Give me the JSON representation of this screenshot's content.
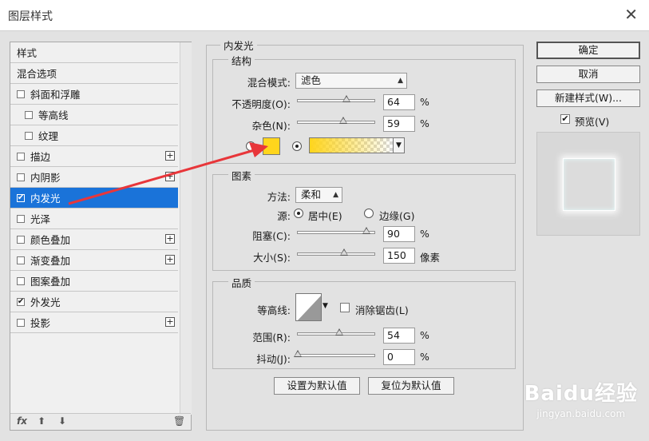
{
  "window": {
    "title": "图层样式",
    "close": "✕"
  },
  "style_list": {
    "items": [
      {
        "label": "样式",
        "checkbox": false,
        "plus": false,
        "indent": 0
      },
      {
        "label": "混合选项",
        "checkbox": false,
        "plus": false,
        "indent": 0
      },
      {
        "label": "斜面和浮雕",
        "checkbox": true,
        "checked": false,
        "plus": false,
        "indent": 0
      },
      {
        "label": "等高线",
        "checkbox": true,
        "checked": false,
        "plus": false,
        "indent": 1
      },
      {
        "label": "纹理",
        "checkbox": true,
        "checked": false,
        "plus": false,
        "indent": 1
      },
      {
        "label": "描边",
        "checkbox": true,
        "checked": false,
        "plus": true,
        "indent": 0
      },
      {
        "label": "内阴影",
        "checkbox": true,
        "checked": false,
        "plus": true,
        "indent": 0
      },
      {
        "label": "内发光",
        "checkbox": true,
        "checked": true,
        "plus": false,
        "indent": 0,
        "selected": true
      },
      {
        "label": "光泽",
        "checkbox": true,
        "checked": false,
        "plus": false,
        "indent": 0
      },
      {
        "label": "颜色叠加",
        "checkbox": true,
        "checked": false,
        "plus": true,
        "indent": 0
      },
      {
        "label": "渐变叠加",
        "checkbox": true,
        "checked": false,
        "plus": true,
        "indent": 0
      },
      {
        "label": "图案叠加",
        "checkbox": true,
        "checked": false,
        "plus": false,
        "indent": 0
      },
      {
        "label": "外发光",
        "checkbox": true,
        "checked": true,
        "plus": false,
        "indent": 0
      },
      {
        "label": "投影",
        "checkbox": true,
        "checked": false,
        "plus": true,
        "indent": 0
      }
    ],
    "footer": {
      "fx": "fx",
      "up": "⬆",
      "down": "⬇",
      "trash": "🗑"
    }
  },
  "panel": {
    "title": "内发光",
    "structure": {
      "legend": "结构",
      "blend_mode_label": "混合模式:",
      "blend_mode_value": "滤色",
      "opacity_label": "不透明度(O):",
      "opacity_value": "64",
      "opacity_unit": "%",
      "opacity_fraction": 0.64,
      "noise_label": "杂色(N):",
      "noise_value": "59",
      "noise_unit": "%",
      "noise_fraction": 0.59,
      "glow_color": "#ffd51c"
    },
    "elements": {
      "legend": "图素",
      "method_label": "方法:",
      "method_value": "柔和",
      "source_label": "源:",
      "source_center": "居中(E)",
      "source_edge": "边缘(G)",
      "choke_label": "阻塞(C):",
      "choke_value": "90",
      "choke_unit": "%",
      "choke_fraction": 0.9,
      "size_label": "大小(S):",
      "size_value": "150",
      "size_unit": "像素",
      "size_fraction": 0.6
    },
    "quality": {
      "legend": "品质",
      "contour_label": "等高线:",
      "antialias_label": "消除锯齿(L)",
      "range_label": "范围(R):",
      "range_value": "54",
      "range_unit": "%",
      "range_fraction": 0.54,
      "jitter_label": "抖动(J):",
      "jitter_value": "0",
      "jitter_unit": "%",
      "jitter_fraction": 0.0
    },
    "buttons": {
      "make_default": "设置为默认值",
      "reset_default": "复位为默认值"
    }
  },
  "right": {
    "ok": "确定",
    "cancel": "取消",
    "new_style": "新建样式(W)...",
    "preview_label": "预览(V)",
    "preview_checked": true
  },
  "watermark": {
    "brand": "Baidu经验",
    "url": "jingyan.baidu.com"
  },
  "annotation_color": "#e8363a"
}
